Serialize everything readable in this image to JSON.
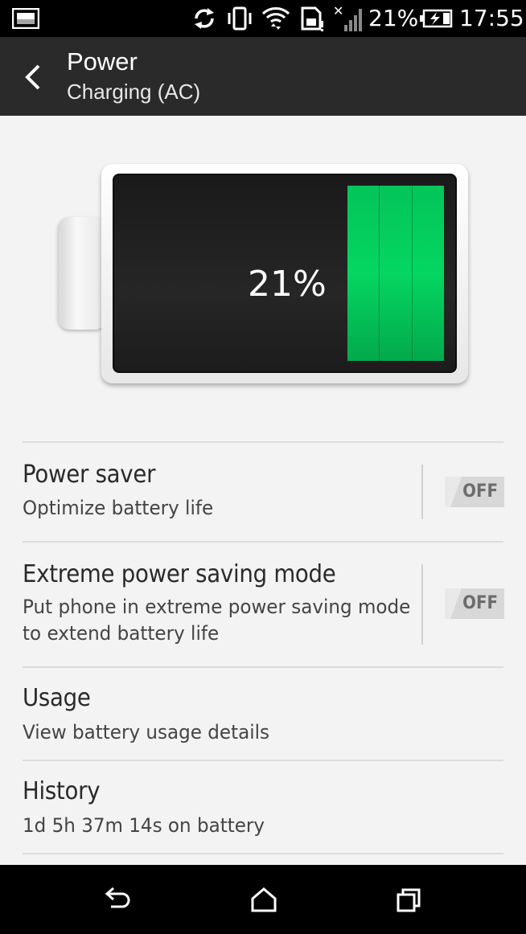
{
  "status_bar": {
    "battery_percent": "21%",
    "time": "17:55",
    "icons": [
      "gallery-icon",
      "sync-icon",
      "vibrate-icon",
      "wifi-icon",
      "storage-icon",
      "no-signal-icon",
      "battery-charging-icon"
    ]
  },
  "app_bar": {
    "title": "Power",
    "subtitle": "Charging (AC)"
  },
  "battery": {
    "label": "21%",
    "level": 0.21,
    "fill_color": "#04d661"
  },
  "settings": {
    "power_saver": {
      "title": "Power saver",
      "subtitle": "Optimize battery life",
      "toggle": "OFF"
    },
    "extreme": {
      "title": "Extreme power saving mode",
      "subtitle_line1": "Put phone in extreme power saving mode",
      "subtitle_line2": "to extend battery life",
      "toggle": "OFF"
    },
    "usage": {
      "title": "Usage",
      "subtitle": "View battery usage details"
    },
    "history": {
      "title": "History",
      "subtitle": "1d 5h 37m 14s on battery"
    }
  },
  "nav_bar": {
    "buttons": [
      "back-icon",
      "home-icon",
      "recent-apps-icon"
    ]
  }
}
